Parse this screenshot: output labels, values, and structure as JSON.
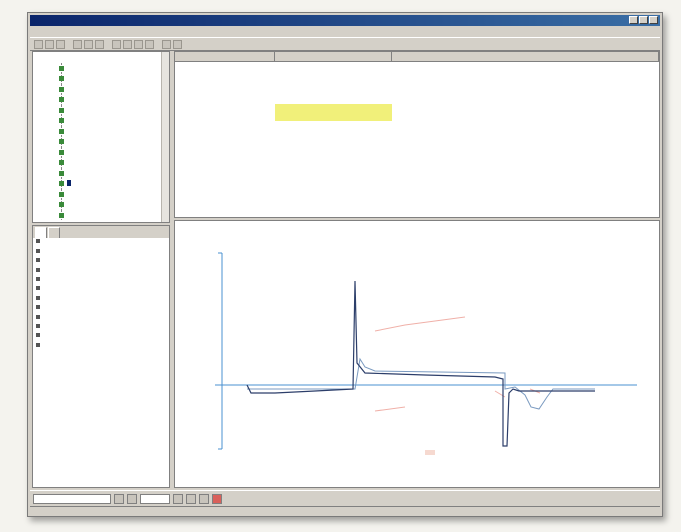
{
  "window": {
    "title": ""
  },
  "menu": {
    "items": [
      "",
      "",
      "",
      "",
      "",
      "",
      "",
      ""
    ]
  },
  "tree": {
    "root_label": "",
    "items": [
      {
        "label": ""
      },
      {
        "label": ""
      },
      {
        "label": ""
      },
      {
        "label": ""
      },
      {
        "label": ""
      },
      {
        "label": ""
      },
      {
        "label": ""
      },
      {
        "label": ""
      },
      {
        "label": ""
      },
      {
        "label": ""
      },
      {
        "label": ""
      },
      {
        "label": "",
        "selected": true
      },
      {
        "label": ""
      },
      {
        "label": ""
      },
      {
        "label": ""
      }
    ]
  },
  "properties": {
    "tabs": [
      "",
      ""
    ],
    "rows": [
      {
        "key": "",
        "value": ""
      },
      {
        "key": "",
        "value": ""
      },
      {
        "key": "",
        "value": ""
      },
      {
        "key": "",
        "value": ""
      },
      {
        "key": "",
        "value": ""
      },
      {
        "key": "",
        "value": ""
      },
      {
        "key": "",
        "value": ""
      },
      {
        "key": "",
        "value": ""
      },
      {
        "key": "",
        "value": ""
      },
      {
        "key": "",
        "value": ""
      },
      {
        "key": "",
        "value": ""
      },
      {
        "key": "",
        "value": ""
      }
    ]
  },
  "table": {
    "columns": [
      "",
      "",
      ""
    ],
    "rows": [
      [
        "",
        "",
        ""
      ],
      [
        "",
        "",
        ""
      ],
      [
        "",
        "",
        ""
      ],
      [
        "",
        "",
        ""
      ],
      [
        "",
        "",
        ""
      ],
      [
        "",
        "",
        ""
      ],
      [
        "",
        "",
        ""
      ],
      [
        "",
        "",
        ""
      ],
      [
        "",
        "",
        ""
      ]
    ],
    "highlighted_rows": [
      5,
      6
    ],
    "highlight_color": "#f1f07a"
  },
  "chart": {
    "title": "",
    "colors": {
      "title": "#2ba0b0",
      "axis": "#4a90d0",
      "trace_dark": "#2c3e6a",
      "trace_light": "#7a9ac0",
      "faint": "#f0b0a8"
    }
  },
  "status": {
    "field": "",
    "left": "",
    "right": ""
  }
}
